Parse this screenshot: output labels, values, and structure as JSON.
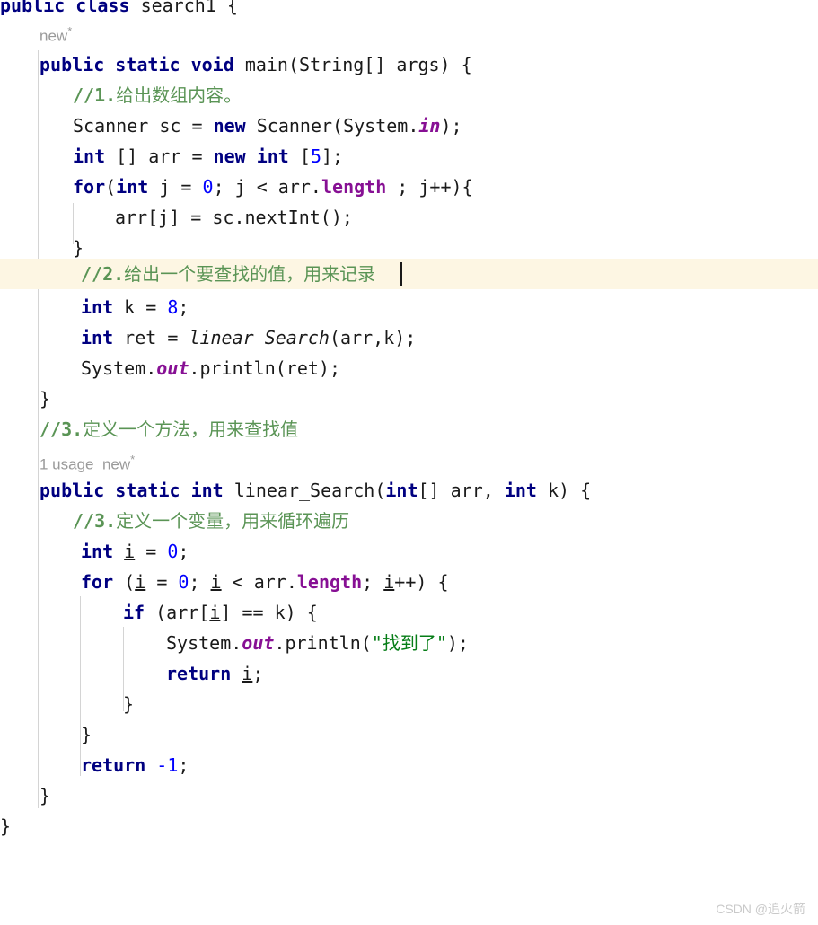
{
  "editor": {
    "language": "java",
    "theme": "light",
    "background_color": "#ffffff",
    "current_line_highlight_color": "#fdf6e3",
    "indent_guide_color": "#d4d4d4",
    "colors": {
      "keyword": "#000080",
      "number": "#0000ff",
      "field": "#871094",
      "string": "#067d17",
      "comment": "#5a9455",
      "text": "#1a1a1a",
      "hint": "#9a9a9a"
    }
  },
  "code_lines": [
    {
      "id": "l01",
      "text": "public class search1 {"
    },
    {
      "id": "l02",
      "text": "    public static void main(String[] args) {"
    },
    {
      "id": "l03",
      "text": "        //1.给出数组内容。"
    },
    {
      "id": "l04",
      "text": "        Scanner sc = new Scanner(System.in);"
    },
    {
      "id": "l05",
      "text": "        int [] arr = new int [5];"
    },
    {
      "id": "l06",
      "text": "        for(int j = 0 ; j < arr.length ; j++){"
    },
    {
      "id": "l07",
      "text": "            arr[j] = sc.nextInt();"
    },
    {
      "id": "l08",
      "text": "        }"
    },
    {
      "id": "l09",
      "text": "        //2.给出一个要查找的值，用来记录"
    },
    {
      "id": "l10",
      "text": "        int k = 8;"
    },
    {
      "id": "l11",
      "text": "        int ret = linear_Search(arr,k);"
    },
    {
      "id": "l12",
      "text": "        System.out.println(ret);"
    },
    {
      "id": "l13",
      "text": "    }"
    },
    {
      "id": "l14",
      "text": "    //3.定义一个方法，用来查找值"
    },
    {
      "id": "l15",
      "text": "    public static int linear_Search(int[] arr, int k) {"
    },
    {
      "id": "l16",
      "text": "        //3.定义一个变量，用来循环遍历"
    },
    {
      "id": "l17",
      "text": "        int i = 0;"
    },
    {
      "id": "l18",
      "text": "        for (i = 0; i < arr.length; i++) {"
    },
    {
      "id": "l19",
      "text": "            if (arr[i] == k) {"
    },
    {
      "id": "l20",
      "text": "                System.out.println(\"找到了\");"
    },
    {
      "id": "l21",
      "text": "                return i;"
    },
    {
      "id": "l22",
      "text": "            }"
    },
    {
      "id": "l23",
      "text": "        }"
    },
    {
      "id": "l24",
      "text": "        return -1;"
    },
    {
      "id": "l25",
      "text": "    }"
    },
    {
      "id": "l26",
      "text": "}"
    }
  ],
  "tokens": {
    "l01": {
      "kw1": "public",
      "kw2": "class",
      "name": "search1",
      "brace": "{"
    },
    "l02": {
      "kw1": "public",
      "kw2": "static",
      "kw3": "void",
      "name": "main",
      "params": "(String[] args) {"
    },
    "l03": {
      "comment_marker": "//1.",
      "comment_text": "给出数组内容。"
    },
    "l04": {
      "type": "Scanner",
      "var": "sc",
      "eq": "=",
      "kw_new": "new",
      "ctor": "Scanner(System.",
      "field": "in",
      "tail": ");"
    },
    "l05": {
      "kw_int": "int",
      "brackets": "[] arr =",
      "kw_new": "new",
      "kw_int2": "int",
      "open": "[",
      "num": "5",
      "close": "];"
    },
    "l06": {
      "kw_for": "for",
      "open": "(",
      "kw_int": "int",
      "var": "j =",
      "num": "0",
      "mid": "; j < arr.",
      "field": "length",
      "tail": " ; j++){"
    },
    "l07": {
      "text": "arr[j] = sc.nextInt();"
    },
    "l08": {
      "text": "}"
    },
    "l09": {
      "comment_marker": "//2.",
      "comment_text": "给出一个要查找的值，用来记录"
    },
    "l10": {
      "kw_int": "int",
      "var": "k =",
      "num": "8",
      "tail": ";"
    },
    "l11": {
      "kw_int": "int",
      "var": "ret =",
      "method": "linear_Search",
      "tail": "(arr,k);"
    },
    "l12": {
      "sys": "System.",
      "field": "out",
      "tail": ".println(ret);"
    },
    "l13": {
      "text": "}"
    },
    "l14": {
      "comment_marker": "//3.",
      "comment_text": "定义一个方法，用来查找值"
    },
    "l15": {
      "kw1": "public",
      "kw2": "static",
      "kw3": "int",
      "name": "linear_Search",
      "open": "(",
      "kw4": "int",
      "mid": "[] arr, ",
      "kw5": "int",
      "tail": " k) {"
    },
    "l16": {
      "comment_marker": "//3.",
      "comment_text": "定义一个变量，用来循环遍历"
    },
    "l17": {
      "kw_int": "int",
      "var": "i",
      "eq": "=",
      "num": "0",
      "tail": ";"
    },
    "l18": {
      "kw_for": "for",
      "open": "(",
      "var1": "i",
      "eq": "=",
      "num": "0",
      "semi": "; ",
      "var2": "i",
      "lt": " < arr.",
      "field": "length",
      "semi2": "; ",
      "var3": "i",
      "tail": "++) {"
    },
    "l19": {
      "kw_if": "if",
      "open": " (arr[",
      "var": "i",
      "tail": "] == k) {"
    },
    "l20": {
      "sys": "System.",
      "field": "out",
      "mid": ".println(",
      "string": "\"找到了\"",
      "tail": ");"
    },
    "l21": {
      "kw_return": "return",
      "var": "i",
      "tail": ";"
    },
    "l22": {
      "text": "}"
    },
    "l23": {
      "text": "}"
    },
    "l24": {
      "kw_return": "return",
      "minus": "-",
      "num": "1",
      "tail": ";"
    },
    "l25": {
      "text": "}"
    },
    "l26": {
      "text": "}"
    }
  },
  "inlay_hints": [
    {
      "id": "h1",
      "text": "new",
      "star": "*"
    },
    {
      "id": "h2",
      "usages": "1 usage",
      "text": "new",
      "star": "*"
    }
  ],
  "watermark": {
    "text": "CSDN @追火箭"
  }
}
